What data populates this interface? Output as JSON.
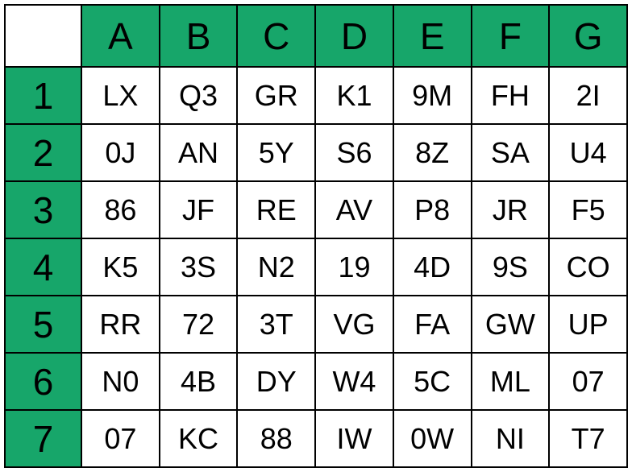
{
  "columns": [
    "A",
    "B",
    "C",
    "D",
    "E",
    "F",
    "G"
  ],
  "rows": [
    "1",
    "2",
    "3",
    "4",
    "5",
    "6",
    "7"
  ],
  "cells": [
    [
      "LX",
      "Q3",
      "GR",
      "K1",
      "9M",
      "FH",
      "2I"
    ],
    [
      "0J",
      "AN",
      "5Y",
      "S6",
      "8Z",
      "SA",
      "U4"
    ],
    [
      "86",
      "JF",
      "RE",
      "AV",
      "P8",
      "JR",
      "F5"
    ],
    [
      "K5",
      "3S",
      "N2",
      "19",
      "4D",
      "9S",
      "CO"
    ],
    [
      "RR",
      "72",
      "3T",
      "VG",
      "FA",
      "GW",
      "UP"
    ],
    [
      "N0",
      "4B",
      "DY",
      "W4",
      "5C",
      "ML",
      "07"
    ],
    [
      "07",
      "KC",
      "88",
      "IW",
      "0W",
      "NI",
      "T7"
    ]
  ]
}
